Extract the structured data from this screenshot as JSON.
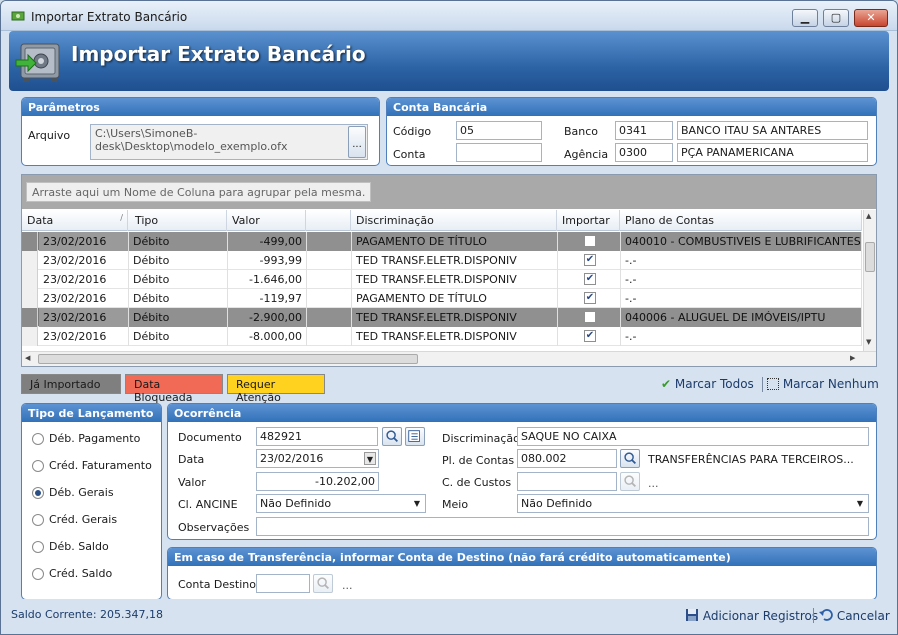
{
  "window": {
    "title": "Importar Extrato Bancário",
    "minimize": "▁",
    "maximize": "▢",
    "close": "✕"
  },
  "banner": {
    "title": "Importar Extrato Bancário"
  },
  "parametros": {
    "header": "Parâmetros",
    "arquivo_label": "Arquivo",
    "arquivo_value": "C:\\Users\\SimoneB-desk\\Desktop\\modelo_exemplo.ofx",
    "arquivo_line1": "C:\\Users\\SimoneB-",
    "arquivo_line2": "desk\\Desktop\\modelo_exemplo.ofx",
    "browse_label": "..."
  },
  "conta": {
    "header": "Conta Bancária",
    "codigo_label": "Código",
    "codigo_value": "05",
    "conta_label": "Conta",
    "conta_value": "",
    "banco_label": "Banco",
    "banco_code": "0341",
    "banco_name": "BANCO ITAU SA  ANTARES",
    "agencia_label": "Agência",
    "agencia_code": "0300",
    "agencia_name": "PÇA PANAMERICANA"
  },
  "grid": {
    "group_hint": "Arraste aqui um Nome de Coluna para agrupar pela mesma.",
    "columns": [
      "Data",
      "Tipo",
      "Valor",
      "",
      "Discriminação",
      "Importar",
      "Plano de Contas"
    ],
    "rows": [
      {
        "data": "23/02/2016",
        "tipo": "Débito",
        "valor": "-499,00",
        "disc": "PAGAMENTO DE TÍTULO",
        "importar": false,
        "plano": "040010 - COMBUSTIVEIS E LUBRIFICANTES",
        "sel": true
      },
      {
        "data": "23/02/2016",
        "tipo": "Débito",
        "valor": "-993,99",
        "disc": "TED TRANSF.ELETR.DISPONIV",
        "importar": true,
        "plano": "-.-",
        "sel": false
      },
      {
        "data": "23/02/2016",
        "tipo": "Débito",
        "valor": "-1.646,00",
        "disc": "TED TRANSF.ELETR.DISPONIV",
        "importar": true,
        "plano": "-.-",
        "sel": false
      },
      {
        "data": "23/02/2016",
        "tipo": "Débito",
        "valor": "-119,97",
        "disc": "PAGAMENTO DE TÍTULO",
        "importar": true,
        "plano": "-.-",
        "sel": false
      },
      {
        "data": "23/02/2016",
        "tipo": "Débito",
        "valor": "-2.900,00",
        "disc": "TED TRANSF.ELETR.DISPONIV",
        "importar": false,
        "plano": "040006 - ALUGUEL DE IMÓVEIS/IPTU",
        "sel": true
      },
      {
        "data": "23/02/2016",
        "tipo": "Débito",
        "valor": "-8.000,00",
        "disc": "TED TRANSF.ELETR.DISPONIV",
        "importar": true,
        "plano": "-.-",
        "sel": false
      }
    ]
  },
  "legend": {
    "ja_importado": "Já Importado",
    "data_bloqueada": "Data Bloqueada",
    "requer_atencao": "Requer Atenção",
    "colors": {
      "ja_importado": "#7f7f7f",
      "data_bloqueada": "#f06a55",
      "requer_atencao": "#ffd21f"
    }
  },
  "marcar": {
    "todos": "Marcar Todos",
    "nenhum": "Marcar Nenhum"
  },
  "tipo_lancamento": {
    "header": "Tipo de Lançamento",
    "options": [
      "Déb. Pagamento",
      "Créd. Faturamento",
      "Déb. Gerais",
      "Créd. Gerais",
      "Déb. Saldo",
      "Créd. Saldo"
    ],
    "selected": "Déb. Gerais"
  },
  "ocorrencia": {
    "header": "Ocorrência",
    "documento_label": "Documento",
    "documento_value": "482921",
    "data_label": "Data",
    "data_value": "23/02/2016",
    "valor_label": "Valor",
    "valor_value": "-10.202,00",
    "ancine_label": "Cl. ANCINE",
    "ancine_value": "Não Definido",
    "obs_label": "Observações",
    "obs_value": "",
    "disc_label": "Discriminação",
    "disc_value": "SAQUE NO CAIXA",
    "plano_label": "Pl. de Contas",
    "plano_code": "080.002",
    "plano_name": "TRANSFERÊNCIAS  PARA  TERCEIROS...",
    "custos_label": "C. de Custos",
    "custos_value": "",
    "custos_desc": "...",
    "meio_label": "Meio",
    "meio_value": "Não Definido"
  },
  "transferencia": {
    "header": "Em caso de Transferência, informar Conta de Destino (não fará crédito automaticamente)",
    "conta_label": "Conta Destino",
    "conta_value": "",
    "conta_desc": "..."
  },
  "status": {
    "saldo": "Saldo Corrente: 205.347,18",
    "adicionar": "Adicionar Registros",
    "cancelar": "Cancelar"
  }
}
